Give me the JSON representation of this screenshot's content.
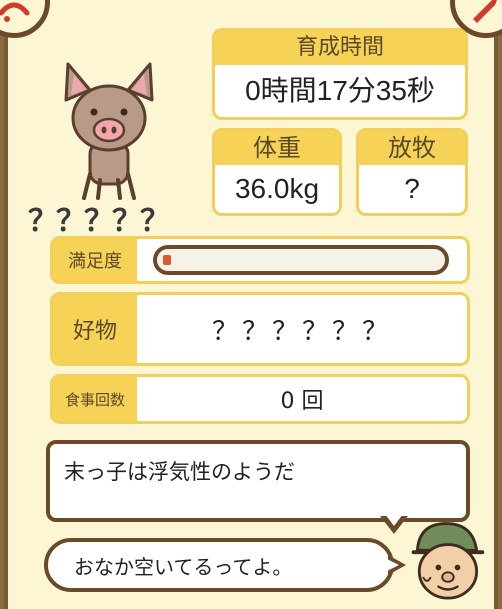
{
  "badges": {
    "left_icon": "rope-icon",
    "right_icon": "knife-icon"
  },
  "pig": {
    "icon": "pig-icon",
    "name": "？？？？？"
  },
  "growth_time": {
    "label": "育成時間",
    "value": "0時間17分35秒"
  },
  "weight": {
    "label": "体重",
    "value": "36.0kg"
  },
  "pasture": {
    "label": "放牧",
    "value": "?"
  },
  "satisfaction": {
    "label": "満足度",
    "level": 0.03
  },
  "favorite": {
    "label": "好物",
    "value": "？？？？？？"
  },
  "meals": {
    "label": "食事回数",
    "value": "0 回"
  },
  "messages": {
    "trait": "末っ子は浮気性のようだ",
    "hint": "おなか空いてるってよ。"
  },
  "farmer": {
    "icon": "farmer-icon"
  },
  "colors": {
    "accent": "#f6d256",
    "border": "#6b4a2a",
    "bar_fill": "#d85a30",
    "panel": "#fcf6d5"
  }
}
